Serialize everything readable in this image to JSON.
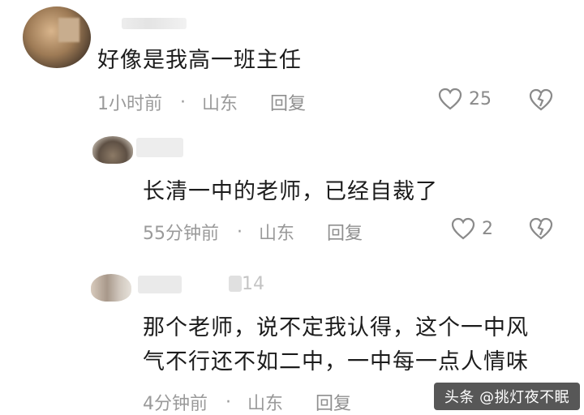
{
  "comments": [
    {
      "text": "好像是我高一班主任",
      "time": "1小时前",
      "location": "山东",
      "reply_label": "回复",
      "likes": "25"
    },
    {
      "text": "长清一中的老师，已经自裁了",
      "time": "55分钟前",
      "location": "山东",
      "reply_label": "回复",
      "likes": "2"
    },
    {
      "username_fragment": "14",
      "text_lines": [
        "那个老师，说不定我认得，这个一中风",
        "气不行还不如二中，一中每一点人情味"
      ],
      "time": "4分钟前",
      "location": "山东",
      "reply_label": "回复"
    }
  ],
  "separator": "·",
  "watermark": "头条 @挑灯夜不眠",
  "colors": {
    "text": "#1c1c1c",
    "meta": "#9a9a9a",
    "icon": "#8a8a8a",
    "watermark_bg": "#282828"
  },
  "icons": [
    "heart-outline-icon",
    "broken-heart-icon"
  ]
}
